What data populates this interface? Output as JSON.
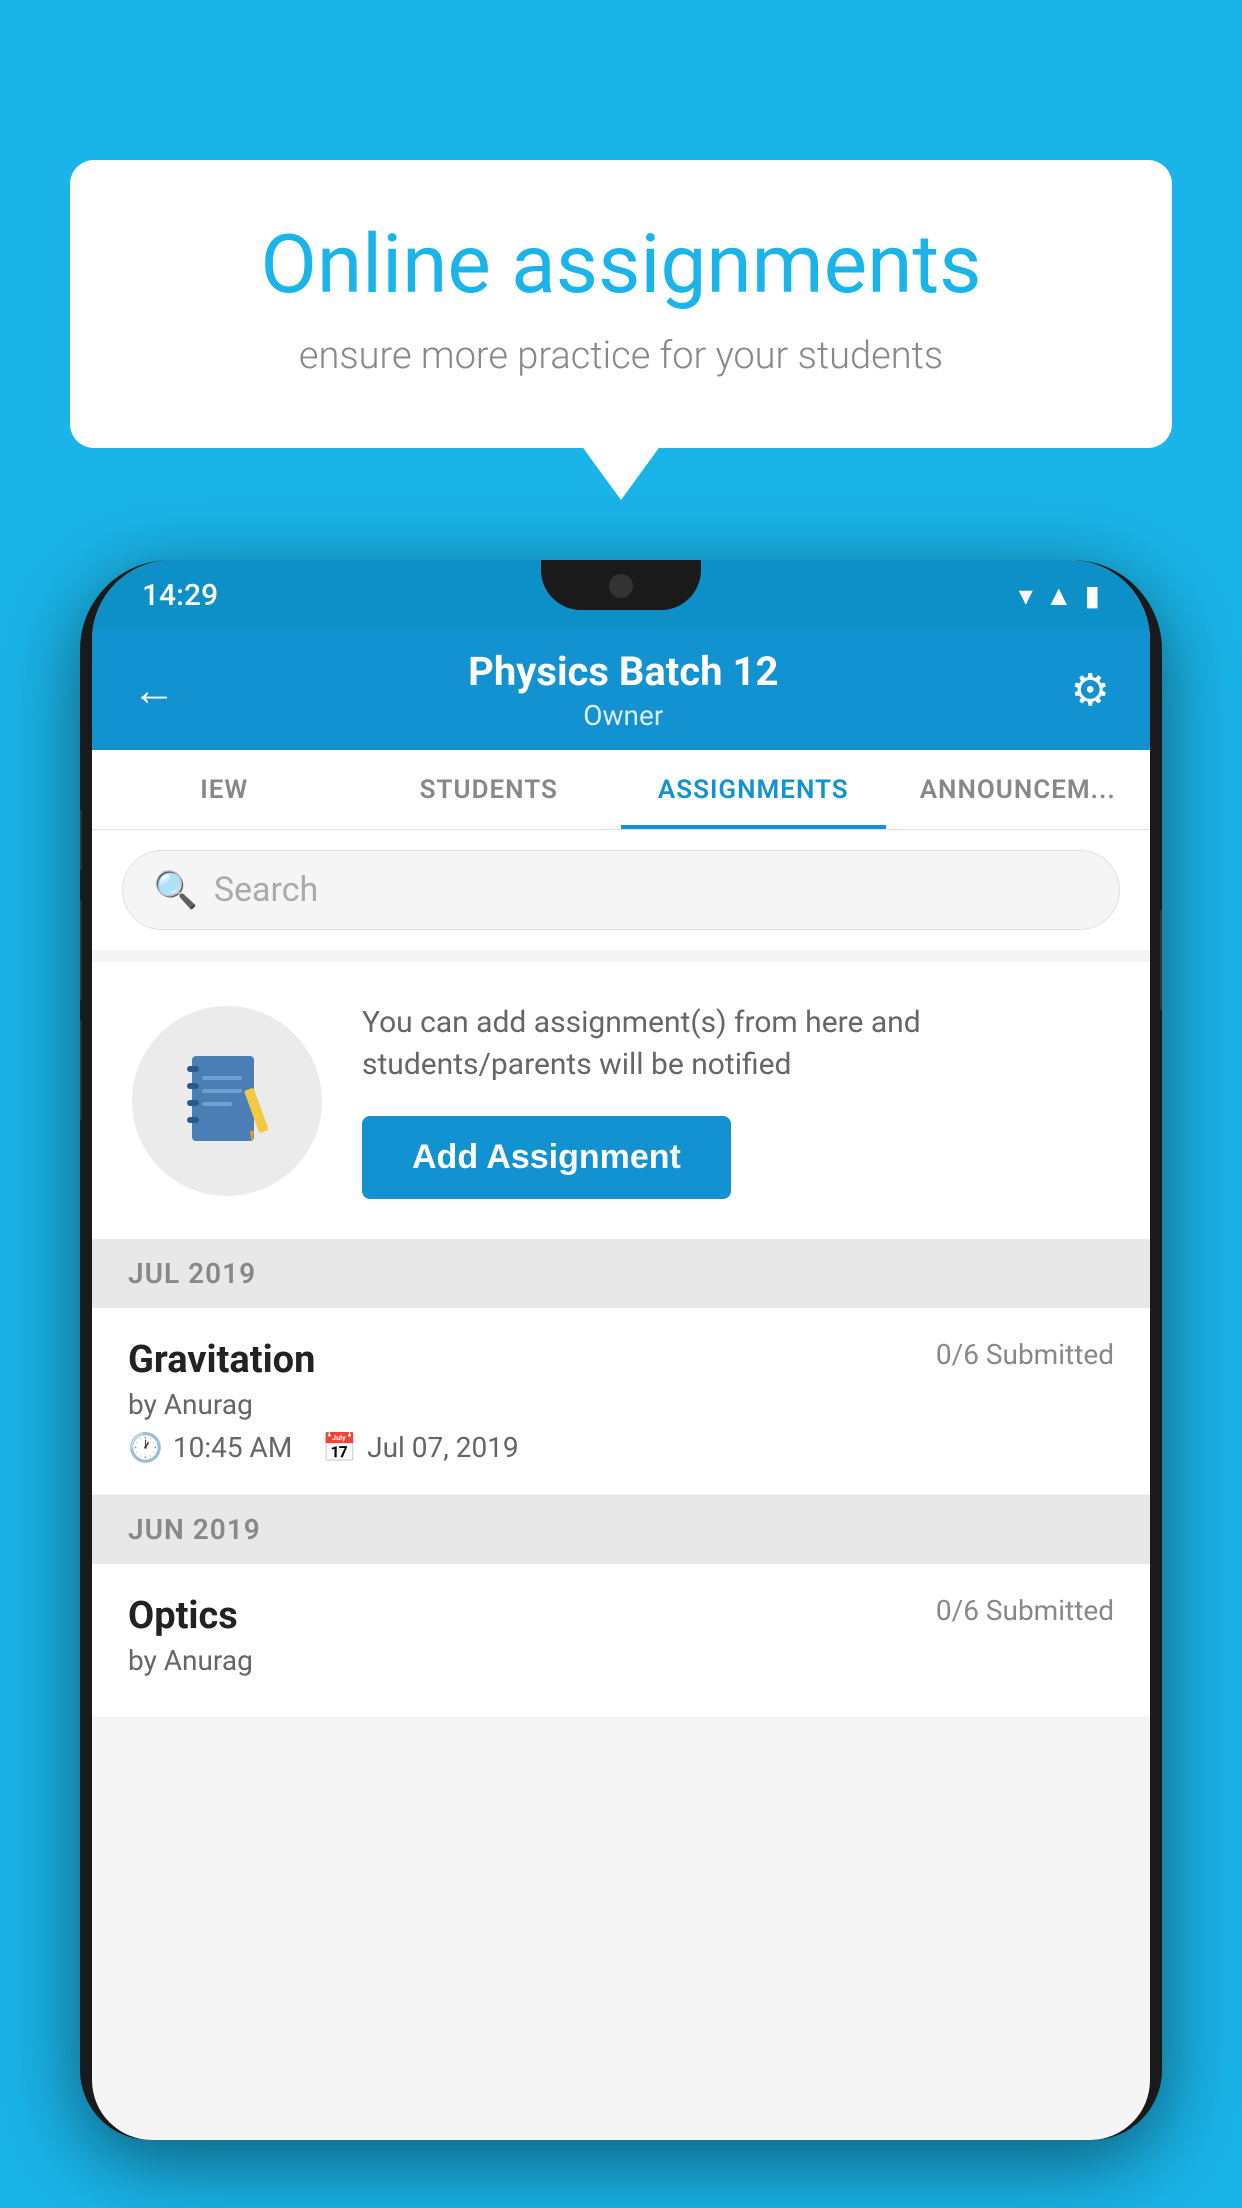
{
  "background_color": "#1ab4e8",
  "speech_bubble": {
    "title": "Online assignments",
    "subtitle": "ensure more practice for your students"
  },
  "status_bar": {
    "time": "14:29",
    "icons": [
      "wifi",
      "signal",
      "battery"
    ]
  },
  "app_header": {
    "title": "Physics Batch 12",
    "subtitle": "Owner",
    "back_label": "←",
    "settings_label": "⚙"
  },
  "tabs": [
    {
      "label": "IEW",
      "active": false
    },
    {
      "label": "STUDENTS",
      "active": false
    },
    {
      "label": "ASSIGNMENTS",
      "active": true
    },
    {
      "label": "ANNOUNCEM...",
      "active": false
    }
  ],
  "search": {
    "placeholder": "Search"
  },
  "promo": {
    "description": "You can add assignment(s) from here and students/parents will be notified",
    "button_label": "Add Assignment"
  },
  "sections": [
    {
      "label": "JUL 2019",
      "assignments": [
        {
          "name": "Gravitation",
          "submitted": "0/6 Submitted",
          "by": "by Anurag",
          "time": "10:45 AM",
          "date": "Jul 07, 2019"
        }
      ]
    },
    {
      "label": "JUN 2019",
      "assignments": [
        {
          "name": "Optics",
          "submitted": "0/6 Submitted",
          "by": "by Anurag",
          "time": "",
          "date": ""
        }
      ]
    }
  ]
}
